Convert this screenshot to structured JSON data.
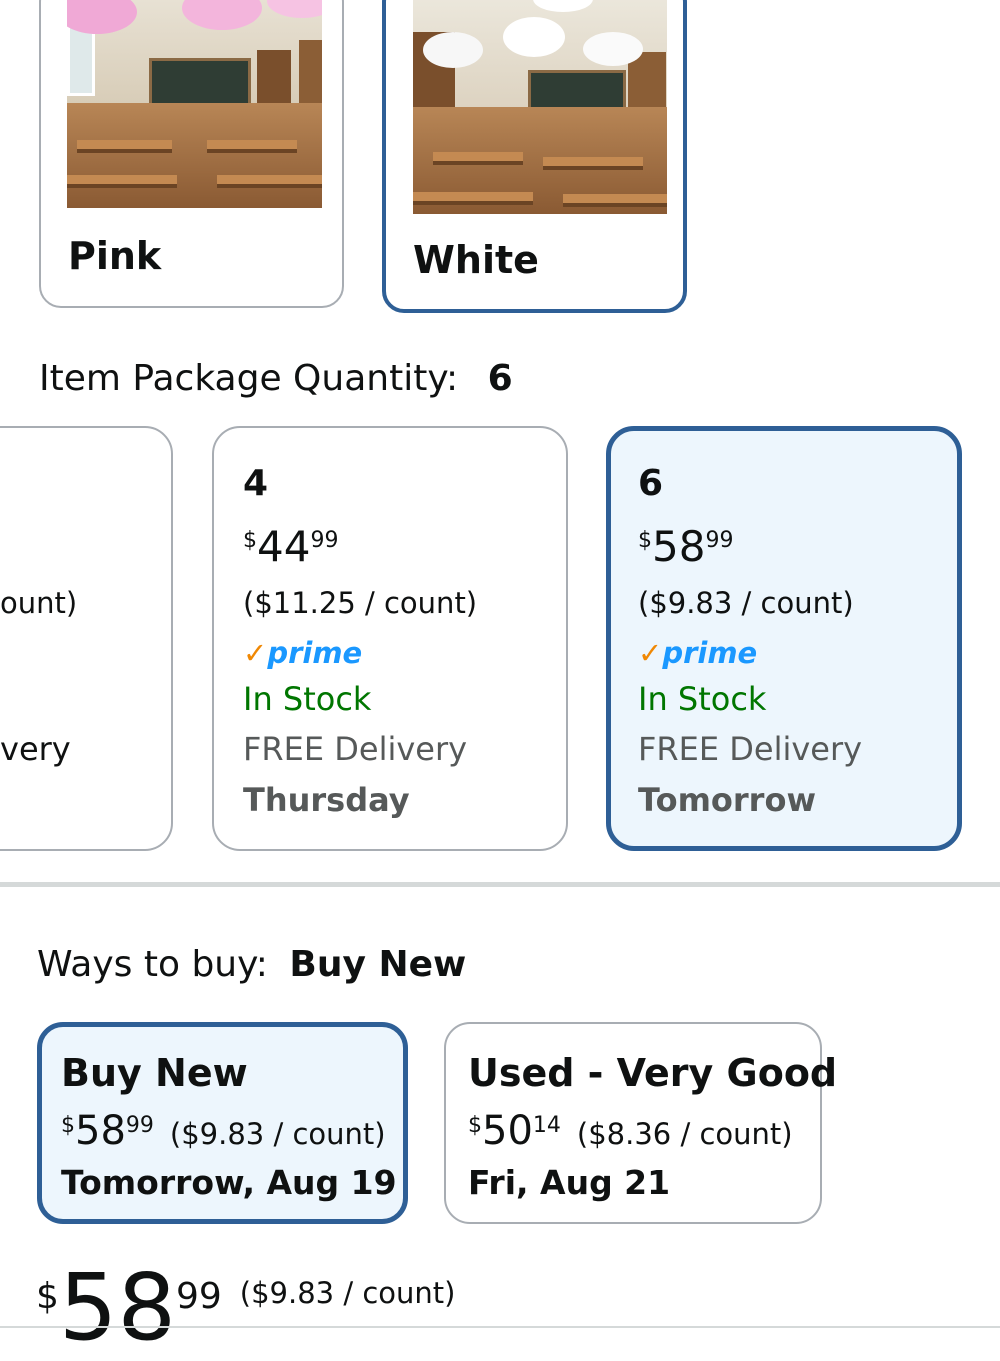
{
  "colors": {
    "selected_border": "#2e5f96",
    "selected_bg": "#edf6fd",
    "in_stock": "#007600",
    "muted_text": "#565959",
    "prime_blue": "#1a98ff",
    "prime_check": "#f08804"
  },
  "color_options": [
    {
      "label": "Pink",
      "selected": false,
      "image": "classroom-pink-clouds"
    },
    {
      "label": "White",
      "selected": true,
      "image": "classroom-white-clouds"
    }
  ],
  "quantity": {
    "title": "Item Package Quantity:",
    "selected_value": "6",
    "cards": [
      {
        "unit_text": "ount)",
        "delivery_text": "very"
      },
      {
        "qty": "4",
        "currency": "$",
        "price_whole": "44",
        "price_fraction": "99",
        "unit_price": "($11.25 / count)",
        "prime_check": "✓",
        "prime_word": "prime",
        "stock": "In Stock",
        "delivery": "FREE Delivery",
        "day": "Thursday"
      },
      {
        "qty": "6",
        "currency": "$",
        "price_whole": "58",
        "price_fraction": "99",
        "unit_price": "($9.83 / count)",
        "prime_check": "✓",
        "prime_word": "prime",
        "stock": "In Stock",
        "delivery": "FREE Delivery",
        "day": "Tomorrow"
      }
    ]
  },
  "ways_to_buy": {
    "label": "Ways to buy:",
    "selected": "Buy New",
    "options": [
      {
        "title": "Buy New",
        "currency": "$",
        "price_whole": "58",
        "price_fraction": "99",
        "unit_price": "($9.83 / count)",
        "date": "Tomorrow, Aug 19"
      },
      {
        "title": "Used - Very Good",
        "currency": "$",
        "price_whole": "50",
        "price_fraction": "14",
        "unit_price": "($8.36 / count)",
        "date": "Fri, Aug 21"
      }
    ]
  },
  "main_price": {
    "currency": "$",
    "whole": "58",
    "fraction": "99",
    "unit_price": "($9.83 / count)"
  }
}
